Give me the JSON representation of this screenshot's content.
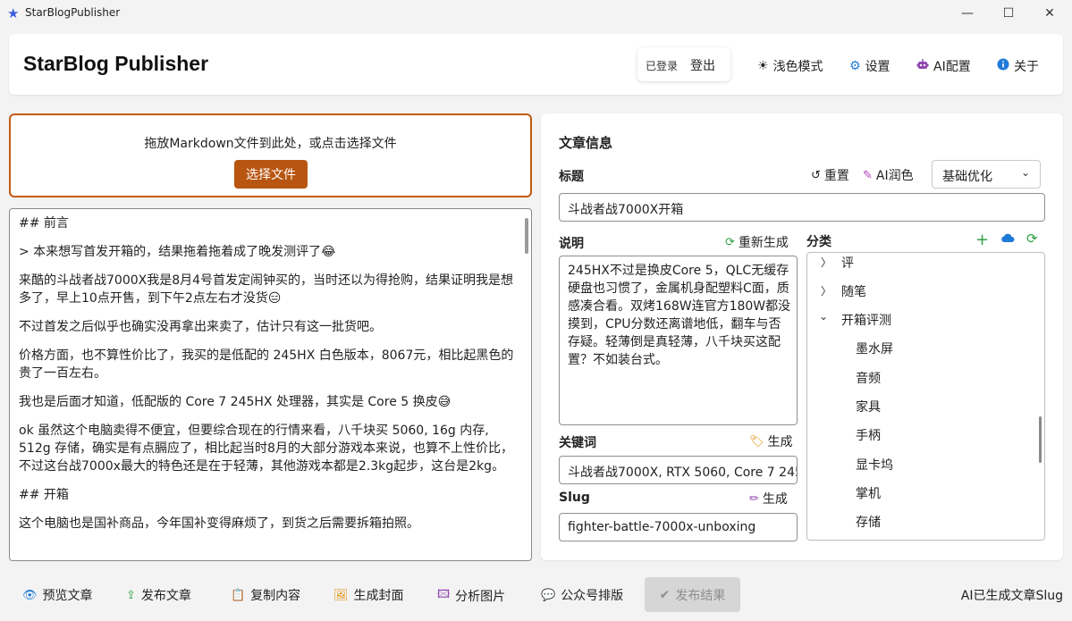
{
  "window": {
    "title": "StarBlogPublisher",
    "controls": [
      "—",
      "☐",
      "✕"
    ]
  },
  "header": {
    "app_name": "StarBlog Publisher",
    "login_status": "已登录",
    "logout_label": "登出",
    "theme_label": "浅色模式",
    "settings_label": "设置",
    "ai_config_label": "AI配置",
    "about_label": "关于"
  },
  "dropzone": {
    "text": "拖放Markdown文件到此处，或点击选择文件",
    "button_label": "选择文件"
  },
  "editor": {
    "lines": [
      "## 前言",
      "> 本来想写首发开箱的，结果拖着拖着成了晚发测评了😂",
      "来酷的斗战者战7000X我是8月4号首发定闹钟买的，当时还以为得抢购，结果证明我是想多了，早上10点开售，到下午2点左右才没货😑",
      "不过首发之后似乎也确实没再拿出来卖了，估计只有这一批货吧。",
      "价格方面，也不算性价比了，我买的是低配的 245HX 白色版本，8067元，相比起黑色的贵了一百左右。",
      "我也是后面才知道，低配版的 Core 7 245HX 处理器，其实是 Core 5 换皮😅",
      "ok 虽然这个电脑卖得不便宜，但要综合现在的行情来看，八千块买 5060, 16g 内存, 512g 存储，确实是有点膈应了，相比起当时8月的大部分游戏本来说，也算不上性价比，不过这台战7000x最大的特色还是在于轻薄，其他游戏本都是2.3kg起步，这台是2kg。",
      "## 开箱",
      "这个电脑也是国补商品，今年国补变得麻烦了，到货之后需要拆箱拍照。"
    ]
  },
  "article": {
    "panel_title": "文章信息",
    "title_label": "标题",
    "reset_label": "重置",
    "ai_polish_label": "AI润色",
    "polish_mode": "基础优化",
    "title_value": "斗战者战7000X开箱",
    "desc_label": "说明",
    "regen_label": "重新生成",
    "desc_value": "245HX不过是换皮Core 5，QLC无缓存硬盘也习惯了，金属机身配塑料C面，质感凑合看。双烤168W连官方180W都没摸到，CPU分数还离谱地低，翻车与否存疑。轻薄倒是真轻薄，八千块买这配置？不如装台式。",
    "keywords_label": "关键词",
    "keywords_gen_label": "生成",
    "keywords_value": "斗战者战7000X, RTX 5060, Core 7 245",
    "slug_label": "Slug",
    "slug_gen_label": "生成",
    "slug_value": "fighter-battle-7000x-unboxing",
    "category_label": "分类",
    "categories": [
      {
        "label": "评",
        "level": 0,
        "expander": "collapsed"
      },
      {
        "label": "随笔",
        "level": 0,
        "expander": "collapsed"
      },
      {
        "label": "开箱评测",
        "level": 0,
        "expander": "expanded"
      },
      {
        "label": "墨水屏",
        "level": 1,
        "expander": "none"
      },
      {
        "label": "音频",
        "level": 1,
        "expander": "none"
      },
      {
        "label": "家具",
        "level": 1,
        "expander": "none"
      },
      {
        "label": "手柄",
        "level": 1,
        "expander": "none"
      },
      {
        "label": "显卡坞",
        "level": 1,
        "expander": "none"
      },
      {
        "label": "掌机",
        "level": 1,
        "expander": "none"
      },
      {
        "label": "存储",
        "level": 1,
        "expander": "none"
      }
    ]
  },
  "toolbar": {
    "preview_label": "预览文章",
    "publish_label": "发布文章",
    "copy_label": "复制内容",
    "cover_label": "生成封面",
    "analyze_label": "分析图片",
    "wechat_label": "公众号排版",
    "result_label": "发布结果",
    "status_text": "AI已生成文章Slug"
  },
  "colors": {
    "accent": "#b85510",
    "accent_border": "#c55a11",
    "green": "#2ea043",
    "blue": "#1f7ad8"
  }
}
